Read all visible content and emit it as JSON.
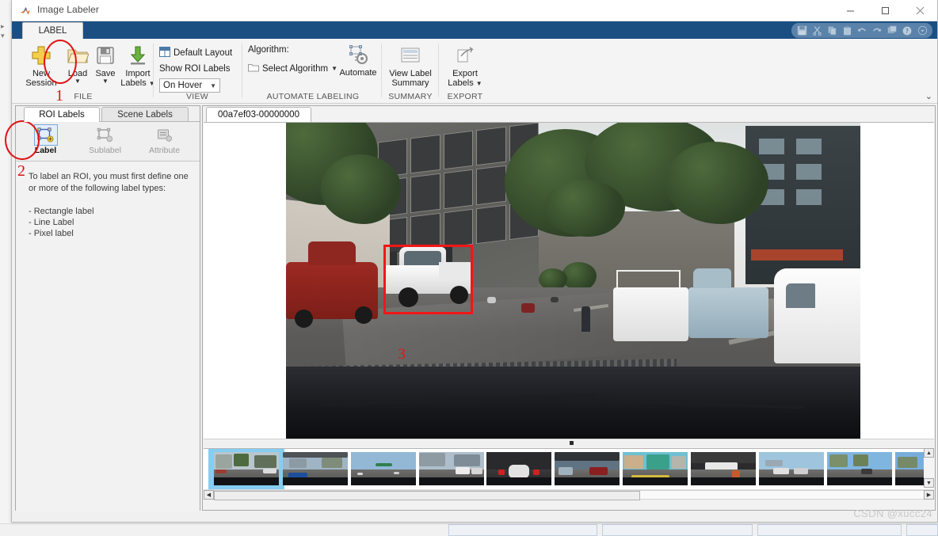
{
  "window": {
    "title": "Image Labeler",
    "app_icon": "matlab-icon",
    "minimize": "—",
    "maximize": "☐",
    "close": "✕"
  },
  "ribbon": {
    "tab": "LABEL",
    "quick_access": [
      {
        "name": "save-icon",
        "glyph": "💾"
      },
      {
        "name": "cut-icon",
        "glyph": "✂"
      },
      {
        "name": "copy-icon",
        "glyph": "⧉"
      },
      {
        "name": "paste-icon",
        "glyph": "📋"
      },
      {
        "name": "undo-icon",
        "glyph": "↶"
      },
      {
        "name": "redo-icon",
        "glyph": "↷"
      },
      {
        "name": "layout-icon",
        "glyph": "◱"
      },
      {
        "name": "help-icon",
        "glyph": "?"
      },
      {
        "name": "more-options-icon",
        "glyph": "▼"
      }
    ],
    "groups": [
      {
        "title": "FILE",
        "buttons": [
          {
            "label_line1": "New",
            "label_line2": "Session",
            "icon": "plus-icon",
            "caret": false
          },
          {
            "label_line1": "Load",
            "label_line2": "",
            "icon": "folder-icon",
            "caret": true
          },
          {
            "label_line1": "Save",
            "label_line2": "",
            "icon": "floppy-disk-icon",
            "caret": true
          },
          {
            "label_line1": "Import",
            "label_line2": "Labels",
            "icon": "import-arrow-icon",
            "caret": true
          }
        ]
      },
      {
        "title": "VIEW",
        "default_layout": "Default Layout",
        "show_roi_labels": "Show ROI Labels",
        "on_hover": "On Hover"
      },
      {
        "title": "AUTOMATE LABELING",
        "algorithm_label": "Algorithm:",
        "select_algorithm": "Select Algorithm",
        "automate": "Automate"
      },
      {
        "title": "SUMMARY",
        "view_label_summary_line1": "View Label",
        "view_label_summary_line2": "Summary"
      },
      {
        "title": "EXPORT",
        "export_labels_line1": "Export",
        "export_labels_line2": "Labels"
      }
    ],
    "collapse": "⌄"
  },
  "left_panel": {
    "tabs": [
      {
        "label": "ROI Labels",
        "active": true
      },
      {
        "label": "Scene Labels",
        "active": false
      }
    ],
    "buttons": [
      {
        "label": "Label",
        "icon": "label-rect-icon",
        "enabled": true
      },
      {
        "label": "Sublabel",
        "icon": "sublabel-icon",
        "enabled": false
      },
      {
        "label": "Attribute",
        "icon": "attribute-icon",
        "enabled": false
      }
    ],
    "help_line1": "To label an ROI, you must first define one",
    "help_line2": "or more of the following label types:",
    "types": [
      "- Rectangle label",
      "- Line Label",
      "- Pixel label"
    ]
  },
  "center": {
    "image_tab": "00a7ef03-00000000",
    "roi": {
      "number": "3",
      "color": "#f21616"
    }
  },
  "annotations": [
    {
      "name": "step-1-marker",
      "number": "1",
      "target": "load-button"
    },
    {
      "name": "step-2-marker",
      "number": "2",
      "target": "label-button"
    }
  ],
  "thumbnails": [
    {
      "id": "thumb-1",
      "selected": true,
      "sky": "#b9c6cd",
      "accent": "#9a3d33"
    },
    {
      "id": "thumb-2",
      "selected": false,
      "sky": "#9fb4c4",
      "accent": "#1b4f9b"
    },
    {
      "id": "thumb-3",
      "selected": false,
      "sky": "#93b8d6",
      "accent": "#2f7f4f"
    },
    {
      "id": "thumb-4",
      "selected": false,
      "sky": "#aebfcb",
      "accent": "#cfcfcf"
    },
    {
      "id": "thumb-5",
      "selected": false,
      "sky": "#2a2a2c",
      "accent": "#d02020"
    },
    {
      "id": "thumb-6",
      "selected": false,
      "sky": "#5f7382",
      "accent": "#8a1f1f"
    },
    {
      "id": "thumb-7",
      "selected": false,
      "sky": "#6fc0d2",
      "accent": "#3ba08a"
    },
    {
      "id": "thumb-8",
      "selected": false,
      "sky": "#2b2b2d",
      "accent": "#c85a2a"
    },
    {
      "id": "thumb-9",
      "selected": false,
      "sky": "#9fc4dd",
      "accent": "#e0e0e0"
    },
    {
      "id": "thumb-10",
      "selected": false,
      "sky": "#7fb6e0",
      "accent": "#7a8f6a"
    },
    {
      "id": "thumb-11",
      "selected": false,
      "sky": "#78aedb",
      "accent": "#4b5a66"
    }
  ],
  "watermark": "CSDN @xucc24",
  "scrollbars": {
    "left_arrow": "◀",
    "right_arrow": "▶",
    "up_arrow": "▲",
    "down_arrow": "▼"
  }
}
